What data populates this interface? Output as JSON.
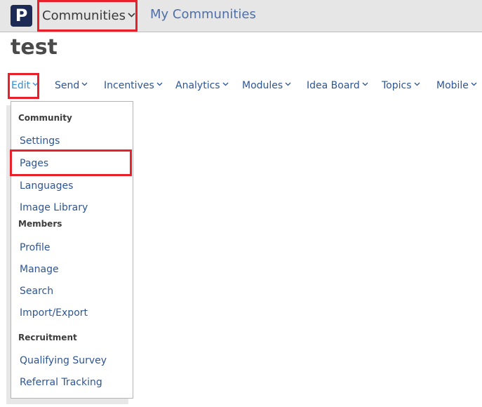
{
  "topbar": {
    "logo_letter": "P",
    "communities_label": "Communities",
    "my_communities_label": "My Communities"
  },
  "page": {
    "title": "test"
  },
  "nav": {
    "items": [
      {
        "label": "Edit",
        "active": true
      },
      {
        "label": "Send"
      },
      {
        "label": "Incentives"
      },
      {
        "label": "Analytics"
      },
      {
        "label": "Modules"
      },
      {
        "label": "Idea Board"
      },
      {
        "label": "Topics"
      },
      {
        "label": "Mobile"
      }
    ]
  },
  "edit_menu": {
    "sections": [
      {
        "heading": "Community",
        "items": [
          "Settings",
          "Pages",
          "Languages",
          "Image Library"
        ]
      },
      {
        "heading": "Members",
        "items": [
          "Profile",
          "Manage",
          "Search",
          "Import/Export"
        ]
      },
      {
        "heading": "Recruitment",
        "items": [
          "Qualifying Survey",
          "Referral Tracking"
        ]
      }
    ]
  },
  "colors": {
    "highlight_red": "#e8202a",
    "link_blue": "#2e5593",
    "active_blue": "#2f8fdc",
    "logo_navy": "#1d2a56"
  }
}
